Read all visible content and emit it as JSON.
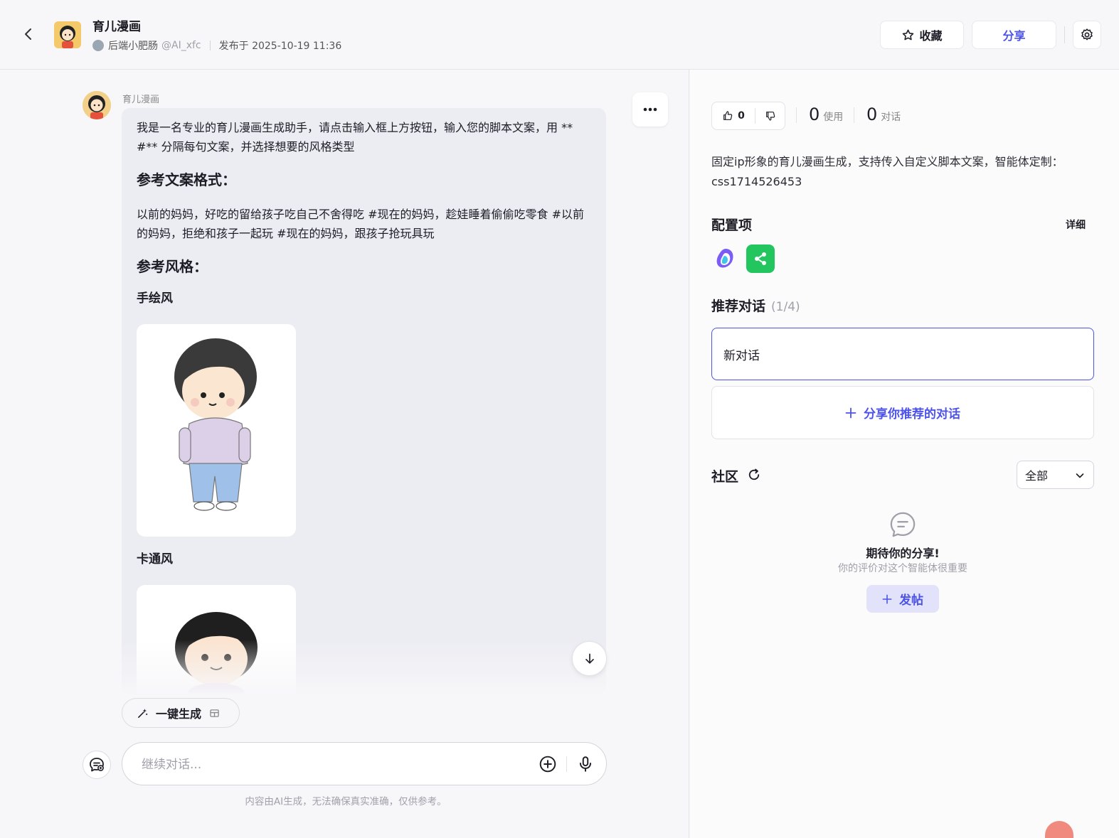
{
  "header": {
    "agent_title": "育儿漫画",
    "author_name": "后端小肥肠",
    "author_handle": "@AI_xfc",
    "published": "发布于 2025-10-19 11:36",
    "favorite_label": "收藏",
    "share_label": "分享"
  },
  "chat": {
    "bot_name": "育儿漫画",
    "intro": "我是一名专业的育儿漫画生成助手，请点击输入框上方按钮，输入您的脚本文案，用 ** #** 分隔每句文案，并选择想要的风格类型",
    "heading_format": "参考文案格式：",
    "format_example": "以前的妈妈，好吃的留给孩子吃自己不舍得吃 #现在的妈妈，趁娃睡着偷偷吃零食 #以前的妈妈，拒绝和孩子一起玩 #现在的妈妈，跟孩子抢玩具玩",
    "heading_style": "参考风格：",
    "style_1": "手绘风",
    "style_2": "卡通风",
    "one_click_label": "一键生成",
    "input_placeholder": "继续对话...",
    "disclaimer": "内容由AI生成，无法确保真实准确，仅供参考。"
  },
  "sidebar": {
    "likes": "0",
    "uses_count": "0",
    "uses_label": "使用",
    "chats_count": "0",
    "chats_label": "对话",
    "description": "固定ip形象的育儿漫画生成，支持传入自定义脚本文案，智能体定制：css1714526453",
    "config_title": "配置项",
    "detail_label": "详细",
    "recommend_title": "推荐对话",
    "recommend_count": "(1/4)",
    "recommend_item": "新对话",
    "share_recommend_label": "分享你推荐的对话",
    "community_title": "社区",
    "filter_selected": "全部",
    "empty_title": "期待你的分享!",
    "empty_subtitle": "你的评价对这个智能体很重要",
    "post_label": "发帖"
  },
  "colors": {
    "accent": "#4d53e8",
    "plugin_green": "#22c55e"
  }
}
